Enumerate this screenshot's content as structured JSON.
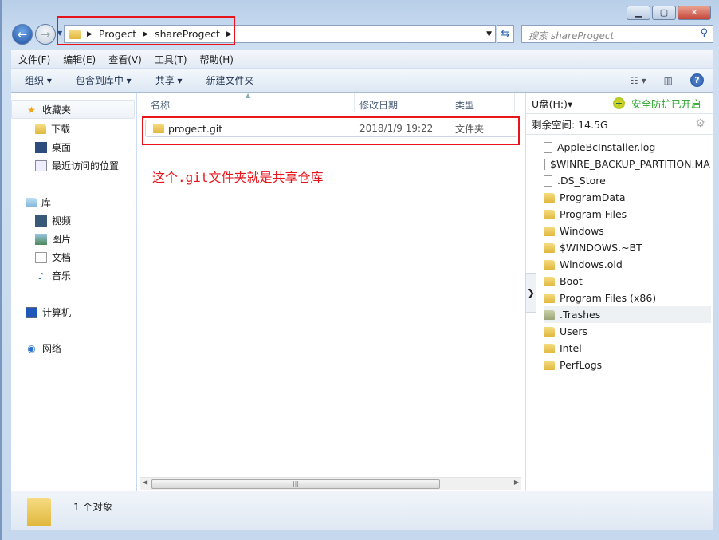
{
  "window": {
    "minimize": "▁",
    "maximize": "▢",
    "close": "✕"
  },
  "nav": {
    "back": "←",
    "forward": "→",
    "path": [
      "Progect",
      "shareProgect"
    ],
    "search_placeholder": "搜索 shareProgect"
  },
  "menu": [
    "文件(F)",
    "编辑(E)",
    "查看(V)",
    "工具(T)",
    "帮助(H)"
  ],
  "toolbar": [
    "组织 ▾",
    "包含到库中 ▾",
    "共享 ▾",
    "新建文件夹"
  ],
  "sidebar": {
    "favorites": {
      "label": "收藏夹",
      "items": [
        "下载",
        "桌面",
        "最近访问的位置"
      ]
    },
    "libraries": {
      "label": "库",
      "items": [
        "视频",
        "图片",
        "文档",
        "音乐"
      ]
    },
    "computer": "计算机",
    "network": "网络"
  },
  "columns": [
    "名称",
    "修改日期",
    "类型"
  ],
  "files": [
    {
      "name": "progect.git",
      "date": "2018/1/9 19:22",
      "type": "文件夹"
    }
  ],
  "annotation": "这个.git文件夹就是共享仓库",
  "annotation_color": "#e8141c",
  "right_panel": {
    "drive": "U盘(H:)▾",
    "protect": "安全防护已开启",
    "free_space": "剩余空间: 14.5G",
    "items": [
      {
        "name": "AppleBcInstaller.log",
        "kind": "file"
      },
      {
        "name": "$WINRE_BACKUP_PARTITION.MARKER",
        "kind": "file"
      },
      {
        "name": ".DS_Store",
        "kind": "file"
      },
      {
        "name": "ProgramData",
        "kind": "folder"
      },
      {
        "name": "Program Files",
        "kind": "folder"
      },
      {
        "name": "Windows",
        "kind": "folder"
      },
      {
        "name": "$WINDOWS.~BT",
        "kind": "folder"
      },
      {
        "name": "Windows.old",
        "kind": "folder"
      },
      {
        "name": "Boot",
        "kind": "folder"
      },
      {
        "name": "Program Files (x86)",
        "kind": "folder"
      },
      {
        "name": ".Trashes",
        "kind": "folder"
      },
      {
        "name": "Users",
        "kind": "folder"
      },
      {
        "name": "Intel",
        "kind": "folder"
      },
      {
        "name": "PerfLogs",
        "kind": "folder"
      }
    ]
  },
  "status": {
    "count": "1 个对象"
  }
}
